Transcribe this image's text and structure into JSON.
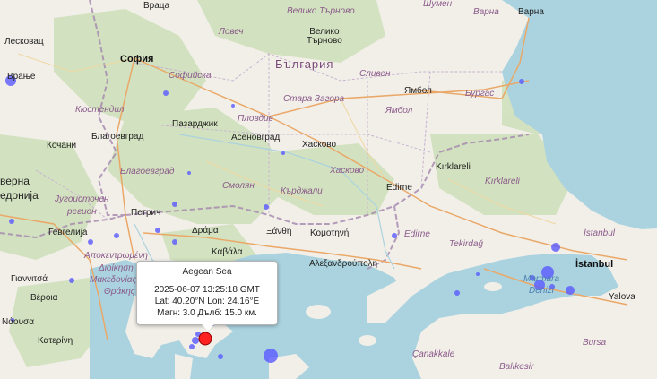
{
  "labels": {
    "vratsa": "Враца",
    "veliko_tarnovo_region": "Велико Търново",
    "shumen": "Шумен",
    "varna_region": "Варна",
    "varna": "Варна",
    "leskovac": "Лесковац",
    "lovech": "Ловеч",
    "veliko_tarnovo": "Велико\nТърново",
    "sofia": "София",
    "bulgaria": "България",
    "vranje": "Врање",
    "sofiyska": "Софийска",
    "sliven": "Сливен",
    "yambol": "Ямбол",
    "burgas": "Бургас",
    "stara_zagora": "Стара Загора",
    "yambol_region": "Ямбол",
    "kyustendil": "Кюстендил",
    "pazardzhik": "Пазарджик",
    "plovdiv": "Пловдив",
    "asenovgrad": "Асеновград",
    "haskovo": "Хасково",
    "kochani": "Кочани",
    "blagoevgrad": "Благоевград",
    "verna": "верна",
    "blagoevgrad_region": "Благоевград",
    "smolyan": "Смолян",
    "haskovo_region": "Хасково",
    "kirklareli": "Kırklareli",
    "kirklareli_region": "Kırklareli",
    "edonia": "едонија",
    "kardzhali": "Кърджали",
    "edirne": "Edirne",
    "yugoistochen": "Југоисточен",
    "region": "регион",
    "petrich": "Петрич",
    "drama": "Δράμα",
    "xanthi": "Ξάνθη",
    "komotini": "Κομοτηνή",
    "gevgelija": "Гевгелија",
    "edirne_region": "Edirne",
    "tekirdag": "Tekirdağ",
    "istanbul_region": "İstanbul",
    "apokentromeni": "Αποκεντρωμένη",
    "kavala": "Καβάλα",
    "alexandroupoli": "Αλεξανδρούπολη",
    "istanbul": "İstanbul",
    "giannitsa": "Γιαννιτσά",
    "dioikisi": "Διοίκηση",
    "makedonia": "Μακεδονίας",
    "thrakis": "Θράκης",
    "marmara": "Marmara",
    "denizi": "Denizi",
    "veroia": "Βέροια",
    "naousa": "Νάουσα",
    "yalova": "Yalova",
    "katerini": "Κατερίνη",
    "canakkale": "Çanakkale",
    "bursa": "Bursa",
    "balikesir": "Balıkesir"
  },
  "popup": {
    "title": "Aegean Sea",
    "time": "2025-06-07 13:25:18 GMT",
    "coords": "Lat: 40.20°N Lon: 24.16°E",
    "details": "Магн: 3.0 Дълб: 15.0 км."
  },
  "colors": {
    "water": "#aad3df",
    "land": "#f2efe9",
    "forest": "#c8dcb4",
    "border": "#9a8aa8",
    "road": "#e8a060",
    "event_marker": "#5a5aff",
    "selected_marker": "#ff2020"
  }
}
